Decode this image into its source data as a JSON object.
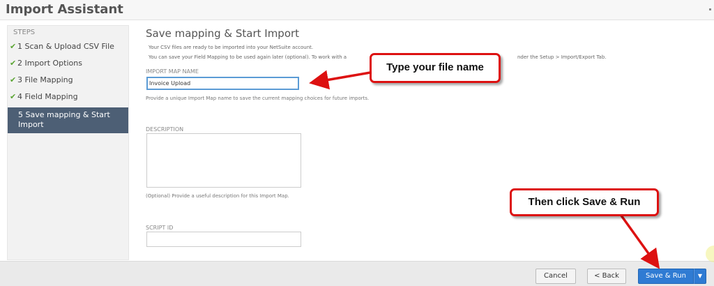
{
  "header": {
    "title": "Import Assistant"
  },
  "sidebar": {
    "heading": "STEPS",
    "steps": [
      {
        "label": "1 Scan & Upload CSV File",
        "done": true
      },
      {
        "label": "2 Import Options",
        "done": true
      },
      {
        "label": "3 File Mapping",
        "done": true
      },
      {
        "label": "4 Field Mapping",
        "done": true
      },
      {
        "label": "5 Save mapping & Start Import",
        "done": false,
        "active": true
      }
    ],
    "check_icon": "✔"
  },
  "main": {
    "title": "Save mapping & Start Import",
    "intro_line1": "Your CSV files are ready to be imported into your NetSuite account.",
    "intro_line2a": "You can save your Field Mapping to be used again later (optional). To work with a",
    "intro_line2b": "nder the Setup > Import/Export Tab.",
    "import_map_name": {
      "label": "IMPORT MAP NAME",
      "value": "Invoice Upload",
      "help": "Provide a unique Import Map name to save the current mapping choices for future imports."
    },
    "description": {
      "label": "DESCRIPTION",
      "value": "",
      "help": "(Optional) Provide a useful description for this Import Map."
    },
    "script_id": {
      "label": "SCRIPT ID",
      "value": ""
    }
  },
  "footer": {
    "cancel": "Cancel",
    "back": "< Back",
    "save_run": "Save & Run",
    "caret": "▼"
  },
  "annotations": {
    "callout1": "Type your file name",
    "callout2": "Then click Save & Run",
    "color": "#dd1111"
  },
  "colors": {
    "active_step_bg": "#4d5f75",
    "primary_button": "#2f7bd3",
    "check": "#5ba534",
    "input_focus": "#5b9bd5"
  }
}
